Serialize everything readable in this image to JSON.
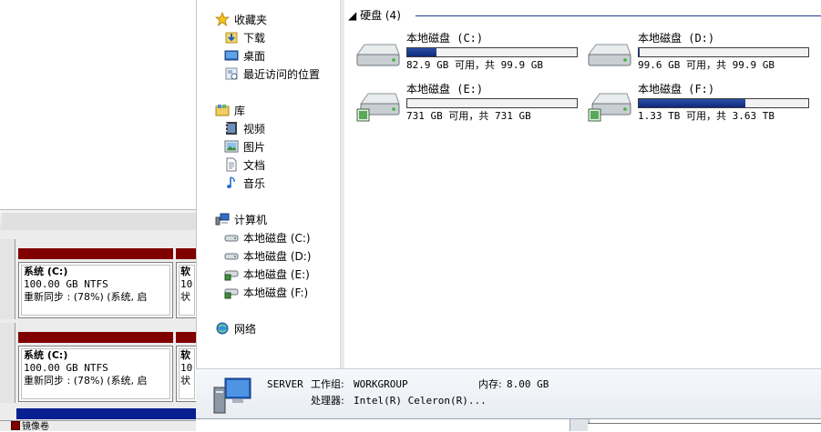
{
  "disk_mgmt": {
    "rows": [
      {
        "vol_title": "系统  (C:)",
        "vol_size": "100.00 GB NTFS",
        "vol_status": "重新同步 : (78%) (系统, 启",
        "vol2_title": "软",
        "vol2_line2": "10",
        "vol2_line3": "状"
      },
      {
        "vol_title": "系统  (C:)",
        "vol_size": "100.00 GB NTFS",
        "vol_status": "重新同步 : (78%) (系统, 启",
        "vol2_title": "软",
        "vol2_line2": "10",
        "vol2_line3": "状"
      }
    ],
    "legend_label": "镜像卷",
    "volume_color": "#800000"
  },
  "nav": {
    "favorites": {
      "label": "收藏夹",
      "items": [
        {
          "label": "下载"
        },
        {
          "label": "桌面"
        },
        {
          "label": "最近访问的位置"
        }
      ]
    },
    "libraries": {
      "label": "库",
      "items": [
        {
          "label": "视频"
        },
        {
          "label": "图片"
        },
        {
          "label": "文档"
        },
        {
          "label": "音乐"
        }
      ]
    },
    "computer": {
      "label": "计算机",
      "items": [
        {
          "label": "本地磁盘 (C:)"
        },
        {
          "label": "本地磁盘 (D:)"
        },
        {
          "label": "本地磁盘 (E:)"
        },
        {
          "label": "本地磁盘 (F:)"
        }
      ]
    },
    "network": {
      "label": "网络"
    }
  },
  "content": {
    "group_header": "硬盘 (4)",
    "drives": [
      {
        "name": "本地磁盘 (C:)",
        "free_text": "82.9 GB 可用，共 99.9 GB",
        "used_fraction": 0.17
      },
      {
        "name": "本地磁盘 (D:)",
        "free_text": "99.6 GB 可用，共 99.9 GB",
        "used_fraction": 0.003
      },
      {
        "name": "本地磁盘 (E:)",
        "free_text": "731 GB 可用，共 731 GB",
        "used_fraction": 0.0
      },
      {
        "name": "本地磁盘 (F:)",
        "free_text": "1.33 TB 可用，共 3.63 TB",
        "used_fraction": 0.63
      }
    ],
    "bar_color": "#12307f"
  },
  "details": {
    "computer_name": "SERVER",
    "workgroup_label": "工作组:",
    "workgroup_value": "WORKGROUP",
    "memory_label": "内存:",
    "memory_value": "8.00 GB",
    "processor_label": "处理器:",
    "processor_value": "Intel(R) Celeron(R)..."
  }
}
